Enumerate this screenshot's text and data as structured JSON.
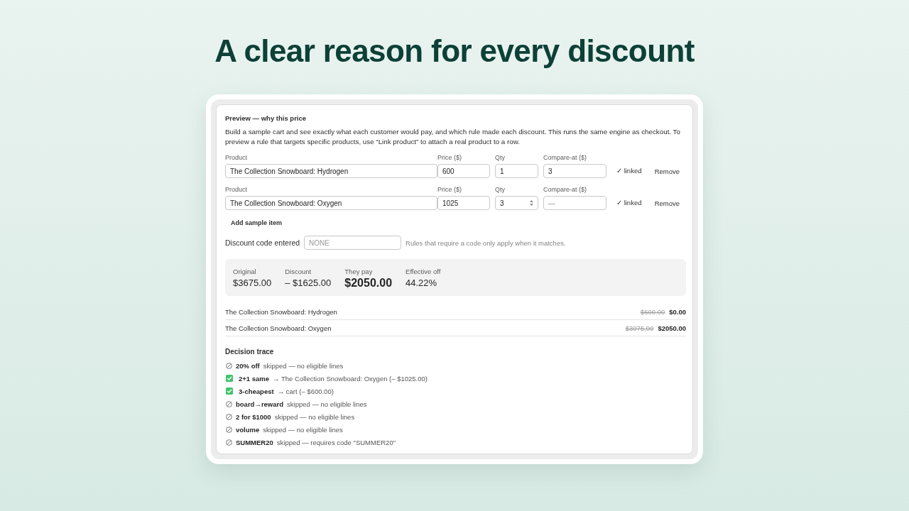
{
  "headline": "A clear reason for every discount",
  "panel": {
    "title": "Preview — why this price",
    "description": "Build a sample cart and see exactly what each customer would pay, and which rule made each discount. This runs the same engine as checkout. To preview a rule that targets specific products, use “Link product” to attach a real product to a row.",
    "items": [
      {
        "product_label": "Product",
        "product": "The Collection Snowboard: Hydrogen",
        "price_label": "Price ($)",
        "price": "600",
        "qty_label": "Qty",
        "qty": "1",
        "spinner_shown": false,
        "compare_label": "Compare-at ($)",
        "compare_at": "3",
        "linked": "✓ linked",
        "remove": "Remove"
      },
      {
        "product_label": "Product",
        "product": "The Collection Snowboard: Oxygen",
        "price_label": "Price ($)",
        "price": "1025",
        "qty_label": "Qty",
        "qty": "3",
        "spinner_shown": true,
        "compare_label": "Compare-at ($)",
        "compare_at_placeholder": "—",
        "linked": "✓ linked",
        "remove": "Remove"
      }
    ],
    "add_button": "Add sample item",
    "discount_code": {
      "label": "Discount code entered",
      "placeholder": "NONE",
      "hint": "Rules that require a code only apply when it matches."
    },
    "summary": [
      {
        "kind": "stat",
        "label": "Original",
        "value": "$3675.00"
      },
      {
        "kind": "stat",
        "label": "Discount",
        "value": "– $1625.00"
      },
      {
        "kind": "total",
        "label": "They pay",
        "value": "$2050.00"
      },
      {
        "kind": "stat",
        "label": "Effective off",
        "value": "44.22%"
      }
    ],
    "lines": [
      {
        "name": "The Collection Snowboard: Hydrogen",
        "original": "$600.00",
        "final": "$0.00"
      },
      {
        "name": "The Collection Snowboard: Oxygen",
        "original": "$3075.00",
        "final": "$2050.00"
      }
    ],
    "trace": {
      "title": "Decision trace",
      "entries": [
        {
          "kind": "skipped",
          "rule": "20% off",
          "detail": "skipped — no eligible lines"
        },
        {
          "kind": "applied",
          "rule": "2+1 same",
          "detail": "→ The Collection Snowboard: Oxygen (– $1025.00)"
        },
        {
          "kind": "applied",
          "rule": "3-cheapest",
          "detail": "→ cart (– $600.00)"
        },
        {
          "kind": "skipped",
          "rule": "board→reward",
          "detail": "skipped — no eligible lines"
        },
        {
          "kind": "skipped",
          "rule": "2 for $1000",
          "detail": "skipped — no eligible lines"
        },
        {
          "kind": "skipped",
          "rule": "volume",
          "detail": "skipped — no eligible lines"
        },
        {
          "kind": "skipped",
          "rule": "SUMMER20",
          "detail": "skipped — requires code \"SUMMER20\""
        }
      ]
    }
  }
}
